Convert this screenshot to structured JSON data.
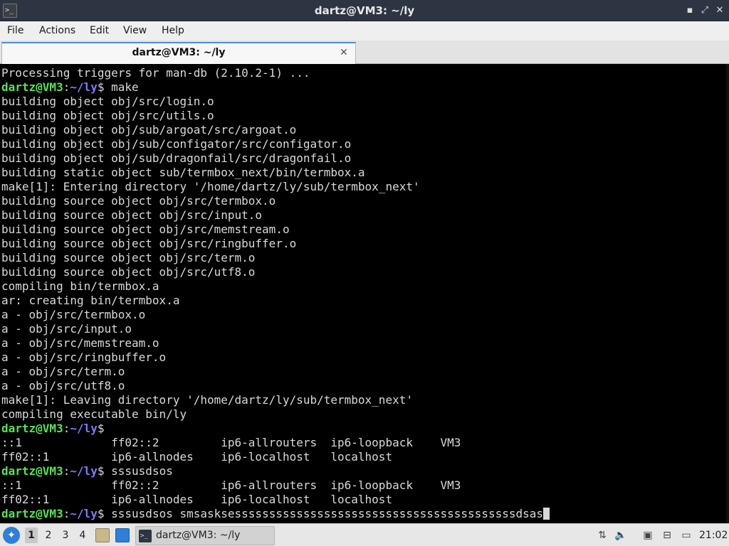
{
  "window": {
    "title": "dartz@VM3: ~/ly",
    "icon": "terminal-icon",
    "minimize_glyph": "▪",
    "maximize_glyph": "⤢",
    "close_glyph": "✕"
  },
  "menu": [
    "File",
    "Actions",
    "Edit",
    "View",
    "Help"
  ],
  "tab": {
    "label": "dartz@VM3: ~/ly",
    "close_glyph": "✕",
    "accent": "#4a90d9"
  },
  "terminal": {
    "colors": {
      "background": "#000000",
      "text": "#d9d9d9",
      "prompt_user": "#5ae05a",
      "prompt_path": "#7b7bff"
    },
    "lines": [
      {
        "t": "Processing triggers for man-db (2.10.2-1) ..."
      },
      {
        "user": "dartz@VM3",
        "colon": ":",
        "path": "~/ly",
        "cmd": "$ make"
      },
      {
        "t": "building object obj/src/login.o"
      },
      {
        "t": "building object obj/src/utils.o"
      },
      {
        "t": "building object obj/sub/argoat/src/argoat.o"
      },
      {
        "t": "building object obj/sub/configator/src/configator.o"
      },
      {
        "t": "building object obj/sub/dragonfail/src/dragonfail.o"
      },
      {
        "t": "building static object sub/termbox_next/bin/termbox.a"
      },
      {
        "t": "make[1]: Entering directory '/home/dartz/ly/sub/termbox_next'"
      },
      {
        "t": "building source object obj/src/termbox.o"
      },
      {
        "t": "building source object obj/src/input.o"
      },
      {
        "t": "building source object obj/src/memstream.o"
      },
      {
        "t": "building source object obj/src/ringbuffer.o"
      },
      {
        "t": "building source object obj/src/term.o"
      },
      {
        "t": "building source object obj/src/utf8.o"
      },
      {
        "t": "compiling bin/termbox.a"
      },
      {
        "t": "ar: creating bin/termbox.a"
      },
      {
        "t": "a - obj/src/termbox.o"
      },
      {
        "t": "a - obj/src/input.o"
      },
      {
        "t": "a - obj/src/memstream.o"
      },
      {
        "t": "a - obj/src/ringbuffer.o"
      },
      {
        "t": "a - obj/src/term.o"
      },
      {
        "t": "a - obj/src/utf8.o"
      },
      {
        "t": "make[1]: Leaving directory '/home/dartz/ly/sub/termbox_next'"
      },
      {
        "t": "compiling executable bin/ly"
      },
      {
        "user": "dartz@VM3",
        "colon": ":",
        "path": "~/ly",
        "cmd": "$"
      },
      {
        "t": "::1             ff02::2         ip6-allrouters  ip6-loopback    VM3"
      },
      {
        "t": "ff02::1         ip6-allnodes    ip6-localhost   localhost"
      },
      {
        "user": "dartz@VM3",
        "colon": ":",
        "path": "~/ly",
        "cmd": "$ sssusdsos"
      },
      {
        "t": "::1             ff02::2         ip6-allrouters  ip6-loopback    VM3"
      },
      {
        "t": "ff02::1         ip6-allnodes    ip6-localhost   localhost"
      },
      {
        "user": "dartz@VM3",
        "colon": ":",
        "path": "~/ly",
        "cmd": "$ sssusdsos smsasksesssssssssssssssssssssssssssssssssssssssssdsas",
        "cursor": true
      }
    ]
  },
  "taskbar": {
    "start_icon": "lxqt-start-icon",
    "workspaces": [
      "1",
      "2",
      "3",
      "4"
    ],
    "active_workspace": "1",
    "quicklaunch": [
      "file-manager-icon",
      "show-desktop-icon"
    ],
    "window_button": {
      "label": "dartz@VM3: ~/ly",
      "icon": "terminal-icon"
    },
    "tray": [
      "update-notifier-icon",
      "volume-icon",
      "clipboard-icon",
      "network-icon",
      "screen-icon"
    ],
    "clock": "21:02"
  }
}
